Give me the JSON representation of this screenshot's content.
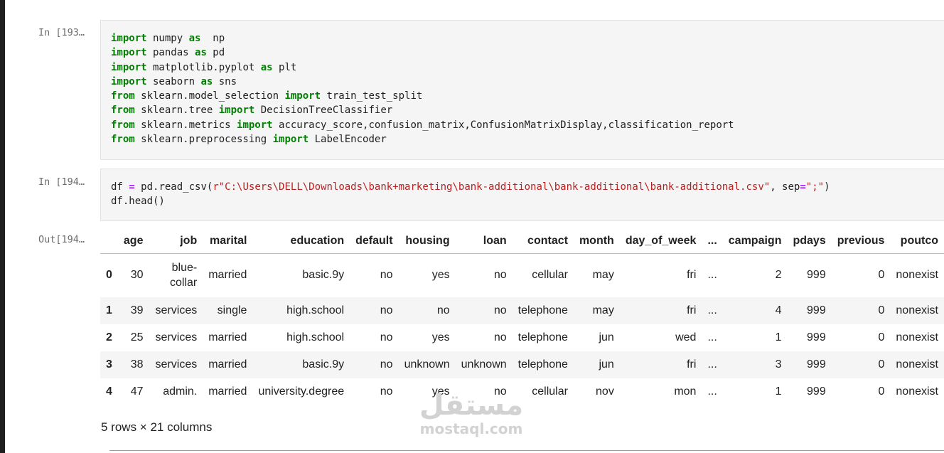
{
  "cells": [
    {
      "prompt": "In [193…",
      "lines": [
        [
          [
            "kw",
            "import"
          ],
          [
            "t",
            " numpy "
          ],
          [
            "kw",
            "as"
          ],
          [
            "t",
            "  np"
          ]
        ],
        [
          [
            "kw",
            "import"
          ],
          [
            "t",
            " pandas "
          ],
          [
            "kw",
            "as"
          ],
          [
            "t",
            " pd"
          ]
        ],
        [
          [
            "kw",
            "import"
          ],
          [
            "t",
            " matplotlib.pyplot "
          ],
          [
            "kw",
            "as"
          ],
          [
            "t",
            " plt"
          ]
        ],
        [
          [
            "kw",
            "import"
          ],
          [
            "t",
            " seaborn "
          ],
          [
            "kw",
            "as"
          ],
          [
            "t",
            " sns"
          ]
        ],
        [
          [
            "kw",
            "from"
          ],
          [
            "t",
            " sklearn.model_selection "
          ],
          [
            "kw",
            "import"
          ],
          [
            "t",
            " train_test_split"
          ]
        ],
        [
          [
            "kw",
            "from"
          ],
          [
            "t",
            " sklearn.tree "
          ],
          [
            "kw",
            "import"
          ],
          [
            "t",
            " DecisionTreeClassifier"
          ]
        ],
        [
          [
            "kw",
            "from"
          ],
          [
            "t",
            " sklearn.metrics "
          ],
          [
            "kw",
            "import"
          ],
          [
            "t",
            " accuracy_score,confusion_matrix,ConfusionMatrixDisplay,classification_report"
          ]
        ],
        [
          [
            "kw",
            "from"
          ],
          [
            "t",
            " sklearn.preprocessing "
          ],
          [
            "kw",
            "import"
          ],
          [
            "t",
            " LabelEncoder"
          ]
        ]
      ]
    },
    {
      "prompt": "In [194…",
      "lines": [
        [
          [
            "t",
            "df "
          ],
          [
            "op",
            "="
          ],
          [
            "t",
            " pd.read_csv("
          ],
          [
            "str",
            "r\"C:\\Users\\DELL\\Downloads\\bank+marketing\\bank-additional\\bank-additional\\bank-additional.csv\""
          ],
          [
            "t",
            ", sep"
          ],
          [
            "op",
            "="
          ],
          [
            "str",
            "\";\""
          ],
          [
            "t",
            ")"
          ]
        ],
        [
          [
            "t",
            "df.head()"
          ]
        ]
      ]
    }
  ],
  "output": {
    "prompt": "Out[194…",
    "columns": [
      "",
      "age",
      "job",
      "marital",
      "education",
      "default",
      "housing",
      "loan",
      "contact",
      "month",
      "day_of_week",
      "...",
      "campaign",
      "pdays",
      "previous",
      "poutco"
    ],
    "rows": [
      [
        "0",
        "30",
        "blue-collar",
        "married",
        "basic.9y",
        "no",
        "yes",
        "no",
        "cellular",
        "may",
        "fri",
        "...",
        "2",
        "999",
        "0",
        "nonexist"
      ],
      [
        "1",
        "39",
        "services",
        "single",
        "high.school",
        "no",
        "no",
        "no",
        "telephone",
        "may",
        "fri",
        "...",
        "4",
        "999",
        "0",
        "nonexist"
      ],
      [
        "2",
        "25",
        "services",
        "married",
        "high.school",
        "no",
        "yes",
        "no",
        "telephone",
        "jun",
        "wed",
        "...",
        "1",
        "999",
        "0",
        "nonexist"
      ],
      [
        "3",
        "38",
        "services",
        "married",
        "basic.9y",
        "no",
        "unknown",
        "unknown",
        "telephone",
        "jun",
        "fri",
        "...",
        "3",
        "999",
        "0",
        "nonexist"
      ],
      [
        "4",
        "47",
        "admin.",
        "married",
        "university.degree",
        "no",
        "yes",
        "no",
        "cellular",
        "nov",
        "mon",
        "...",
        "1",
        "999",
        "0",
        "nonexist"
      ]
    ],
    "footer": "5 rows × 21 columns"
  },
  "watermark": {
    "logo": "مستقل",
    "text": "mostaql.com"
  }
}
